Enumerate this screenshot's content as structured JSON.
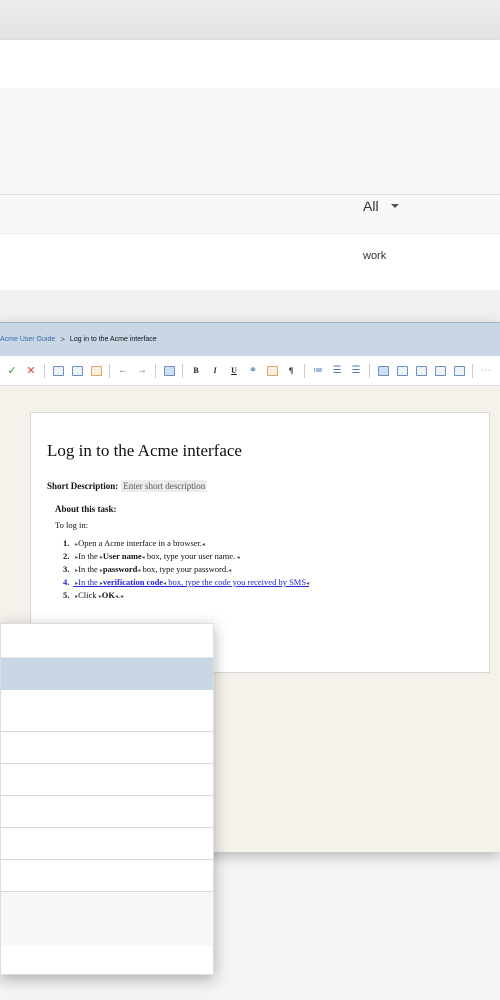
{
  "filter": {
    "selected": "All"
  },
  "list": {
    "row_text": "work"
  },
  "breadcrumb": {
    "parent": "Acme User Guide",
    "separator": ">",
    "current": "Log in to the Acme interface"
  },
  "toolbar": {
    "bold": "B",
    "italic": "I",
    "underline": "U",
    "paragraph": "¶"
  },
  "document": {
    "title": "Log in to the Acme interface",
    "short_desc_label": "Short Description:",
    "short_desc_placeholder": "Enter short description",
    "about_heading": "About this task:",
    "intro": "To log in:",
    "steps": [
      {
        "num": "1.",
        "pre": "Open a Acme interface in a browser.",
        "bold": "",
        "post": ""
      },
      {
        "num": "2.",
        "pre": "In the ",
        "bold": "User name",
        "post": " box, type your user name."
      },
      {
        "num": "3.",
        "pre": "In the ",
        "bold": "password",
        "post": " box, type your password."
      },
      {
        "num": "4.",
        "pre": "In the ",
        "bold": "verification code",
        "post": " box, type the code you received by SMS"
      },
      {
        "num": "5.",
        "pre": "Click ",
        "bold": "OK",
        "post": "."
      }
    ]
  },
  "colors": {
    "breadcrumb_bg": "#c8d6e5",
    "link": "#2323d8",
    "editor_bg": "#f5f2eb"
  }
}
